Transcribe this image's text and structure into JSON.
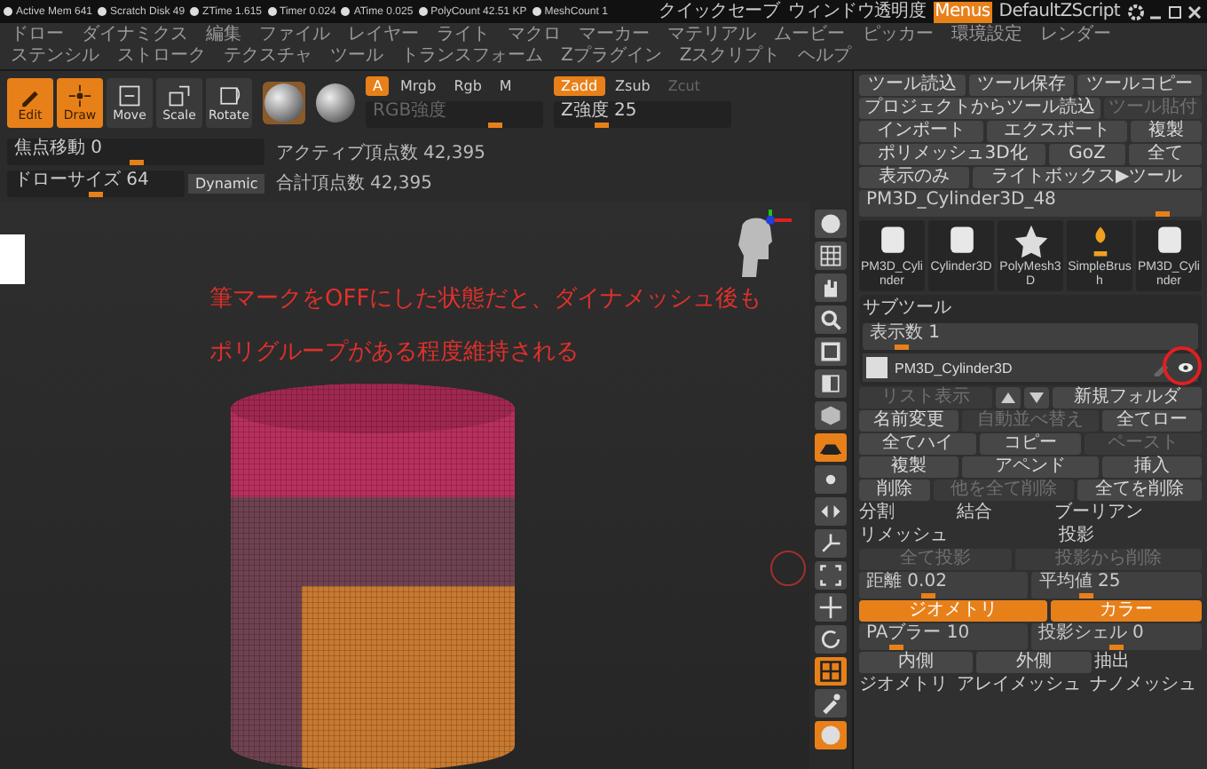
{
  "status_bar": {
    "items": [
      {
        "label": "Active Mem 641"
      },
      {
        "label": "Scratch Disk 49"
      },
      {
        "label": "ZTime 1.615"
      },
      {
        "label": "Timer 0.024"
      },
      {
        "label": "ATime 0.025"
      },
      {
        "label": "PolyCount 42.51 KP"
      },
      {
        "label": "MeshCount 1"
      }
    ],
    "quick": [
      {
        "label": "クイックセーブ",
        "selected": false
      },
      {
        "label": "ウィンドウ透明度",
        "selected": false
      },
      {
        "label": "Menus",
        "selected": true
      },
      {
        "label": "DefaultZScript",
        "selected": false
      }
    ]
  },
  "menu_bar": [
    "ドロー",
    "ダイナミクス",
    "編集",
    "ファイル",
    "レイヤー",
    "ライト",
    "マクロ",
    "マーカー",
    "マテリアル",
    "ムービー",
    "ピッカー",
    "環境設定",
    "レンダー",
    "ステンシル",
    "ストローク",
    "テクスチャ",
    "ツール",
    "トランスフォーム",
    "Zプラグイン",
    "Zスクリプト",
    "ヘルプ"
  ],
  "toolbar": {
    "tools": [
      {
        "label": "Edit",
        "kind": "edit",
        "selected": true
      },
      {
        "label": "Draw",
        "kind": "draw",
        "selected": true
      },
      {
        "label": "Move",
        "kind": "move",
        "selected": false
      },
      {
        "label": "Scale",
        "kind": "scale",
        "selected": false
      },
      {
        "label": "Rotate",
        "kind": "rotate",
        "selected": false
      }
    ],
    "modes": [
      {
        "label": "A",
        "selected": true
      },
      {
        "label": "Mrgb",
        "selected": false
      },
      {
        "label": "Rgb",
        "selected": false
      },
      {
        "label": "M",
        "selected": false
      }
    ],
    "rgb_slider": {
      "label": "RGB強度",
      "level": 0.75,
      "disabled": true
    },
    "z_modes": [
      {
        "label": "Zadd",
        "selected": true,
        "disabled": false
      },
      {
        "label": "Zsub",
        "selected": false,
        "disabled": false
      },
      {
        "label": "Zcut",
        "selected": false,
        "disabled": true
      }
    ],
    "z_slider": {
      "label": "Z強度 25",
      "level": 0.25,
      "disabled": false
    },
    "focal_slider": {
      "label": "焦点移動 0",
      "level": 0.5,
      "disabled": false
    },
    "size_slider": {
      "label": "ドローサイズ 64",
      "level": 0.5,
      "disabled": false
    },
    "dynamic": "Dynamic",
    "counts": [
      "アクティブ頂点数 42,395",
      "合計頂点数 42,395"
    ]
  },
  "canvas": {
    "annotation": [
      "筆マークをOFFにした状態だと、ダイナメッシュ後も",
      "ポリグループがある程度維持される"
    ]
  },
  "shelf": [
    {
      "kind": "sphere",
      "selected": false
    },
    {
      "kind": "grid",
      "selected": false
    },
    {
      "kind": "hand",
      "selected": false
    },
    {
      "kind": "magnifier",
      "selected": false
    },
    {
      "kind": "square",
      "selected": false
    },
    {
      "kind": "half",
      "selected": false
    },
    {
      "kind": "cube",
      "selected": false
    },
    {
      "kind": "floor",
      "selected": true
    },
    {
      "kind": "dot",
      "selected": false
    },
    {
      "kind": "mirror",
      "selected": false
    },
    {
      "kind": "axes",
      "selected": false
    },
    {
      "kind": "frame",
      "selected": false
    },
    {
      "kind": "move",
      "selected": false
    },
    {
      "kind": "rotate",
      "selected": false
    },
    {
      "kind": "poly",
      "selected": true
    },
    {
      "kind": "brush",
      "selected": false
    },
    {
      "kind": "sphere",
      "selected": true
    }
  ],
  "right_panel": {
    "rows": [
      {
        "cells": [
          {
            "label": "ツール読込",
            "kind": "button"
          },
          {
            "label": "ツール保存",
            "kind": "button"
          },
          {
            "label": "ツールコピー",
            "kind": "button"
          }
        ]
      },
      {
        "cells": [
          {
            "label": "プロジェクトからツール読込",
            "kind": "button"
          },
          {
            "label": "ツール貼付",
            "kind": "disabled"
          }
        ]
      },
      {
        "cells": [
          {
            "label": "インポート",
            "kind": "button"
          },
          {
            "label": "エクスポート",
            "kind": "button"
          },
          {
            "label": "複製",
            "kind": "button"
          }
        ]
      },
      {
        "cells": [
          {
            "label": "ポリメッシュ3D化",
            "kind": "button"
          },
          {
            "label": "GoZ",
            "kind": "button"
          },
          {
            "label": "全て",
            "kind": "button"
          }
        ]
      },
      {
        "cells": [
          {
            "label": "表示のみ",
            "kind": "button"
          },
          {
            "label": "ライトボックス▶ツール",
            "kind": "button"
          }
        ]
      },
      {
        "cells": [
          {
            "label": "PM3D_Cylinder3D_48",
            "kind": "slider",
            "level": 0.9
          }
        ]
      }
    ],
    "thumbnails": [
      {
        "label": "PM3D_Cylinder",
        "kind": "cylinder"
      },
      {
        "label": "Cylinder3D",
        "kind": "cylinder"
      },
      {
        "label": "PolyMesh3D",
        "kind": "star"
      },
      {
        "label": "SimpleBrush",
        "kind": "brush"
      },
      {
        "label": "PM3D_Cylinder",
        "kind": "cylinder"
      }
    ],
    "subtool": {
      "title": "サブツール",
      "count": {
        "label": "表示数 1",
        "level": 0.1
      },
      "name": "PM3D_Cylinder3D",
      "brush_on": false
    },
    "rows2": [
      {
        "cells": [
          {
            "label": "リスト表示",
            "kind": "disabled"
          },
          {
            "kind": "up"
          },
          {
            "kind": "down"
          },
          {
            "label": "新規フォルダ",
            "kind": "button"
          }
        ]
      },
      {
        "cells": [
          {
            "label": "名前変更",
            "kind": "button"
          },
          {
            "label": "自動並べ替え",
            "kind": "disabled"
          },
          {
            "label": "全てロー",
            "kind": "button"
          }
        ]
      },
      {
        "cells": [
          {
            "label": "全てハイ",
            "kind": "button"
          },
          {
            "label": "コピー",
            "kind": "button"
          },
          {
            "label": "ペースト",
            "kind": "disabled"
          }
        ]
      },
      {
        "cells": [
          {
            "label": "複製",
            "kind": "button"
          },
          {
            "label": "アペンド",
            "kind": "button"
          },
          {
            "label": "挿入",
            "kind": "button"
          }
        ]
      },
      {
        "cells": [
          {
            "label": "削除",
            "kind": "button"
          },
          {
            "label": "他を全て削除",
            "kind": "disabled"
          },
          {
            "label": "全てを削除",
            "kind": "button"
          }
        ]
      },
      {
        "cells": [
          {
            "label": "分割",
            "kind": "heading"
          },
          {
            "label": "結合",
            "kind": "heading"
          },
          {
            "label": "ブーリアン",
            "kind": "heading"
          }
        ]
      },
      {
        "cells": [
          {
            "label": "リメッシュ",
            "kind": "heading"
          },
          {
            "label": "投影",
            "kind": "heading"
          }
        ]
      },
      {
        "cells": [
          {
            "label": "全て投影",
            "kind": "disabled"
          },
          {
            "label": "投影から削除",
            "kind": "disabled"
          }
        ]
      },
      {
        "cells": [
          {
            "label": "距離 0.02",
            "kind": "slider",
            "level": 0.4
          },
          {
            "label": "平均値 25",
            "kind": "slider",
            "level": 0.3
          }
        ]
      },
      {
        "cells": [
          {
            "label": "ジオメトリ",
            "kind": "active"
          },
          {
            "label": "カラー",
            "kind": "active"
          }
        ]
      },
      {
        "cells": [
          {
            "label": "PAブラー 10",
            "kind": "slider",
            "level": 0.2
          },
          {
            "label": "投影シェル 0",
            "kind": "slider",
            "level": 0.5
          }
        ]
      },
      {
        "cells": [
          {
            "label": "内側",
            "kind": "button"
          },
          {
            "label": "外側",
            "kind": "button"
          },
          {
            "label": "抽出",
            "kind": "heading"
          }
        ]
      },
      {
        "cells": [
          {
            "label": "ジオメトリ",
            "kind": "heading"
          },
          {
            "label": "アレイメッシュ",
            "kind": "heading"
          },
          {
            "label": "ナノメッシュ",
            "kind": "heading"
          }
        ]
      }
    ]
  }
}
